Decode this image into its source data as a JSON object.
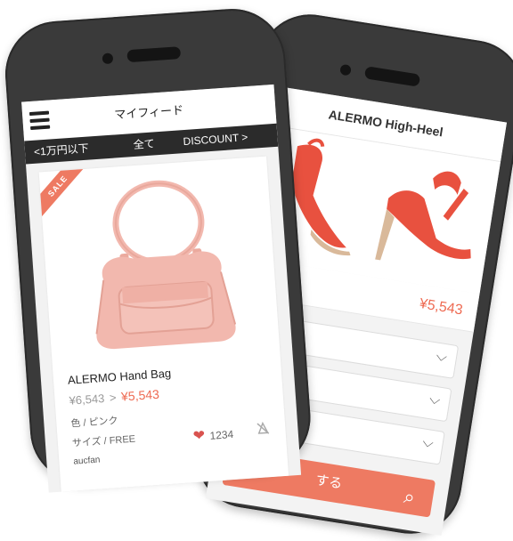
{
  "front": {
    "header": {
      "title": "マイフィード",
      "menu_icon": "hamburger-menu-icon"
    },
    "filter": {
      "left": "<1万円以下",
      "center": "全て",
      "right": "DISCOUNT >"
    },
    "product": {
      "badge": "SALE",
      "name": "ALERMO Hand Bag",
      "old_price": "¥6,543",
      "arrow": ">",
      "new_price": "¥5,543",
      "color": "色 / ピンク",
      "size": "サイズ / FREE",
      "shop": "aucfan",
      "likes": "1234",
      "like_icon": "broken-heart-icon",
      "hide_icon": "hide-icon"
    }
  },
  "back": {
    "header": {
      "title": "ALERMO High-Heel"
    },
    "price": "¥5,543",
    "selects": [
      {
        "chevron": "⌵"
      },
      {
        "chevron": "⌵"
      },
      {
        "chevron": "⌵"
      }
    ],
    "cta": {
      "label": "する",
      "icon": "paperclip-icon"
    }
  },
  "colors": {
    "accent": "#ee6a52",
    "dark": "#2b2b2b",
    "phone": "#3a3a3a",
    "bag": "#f2b8ae"
  }
}
